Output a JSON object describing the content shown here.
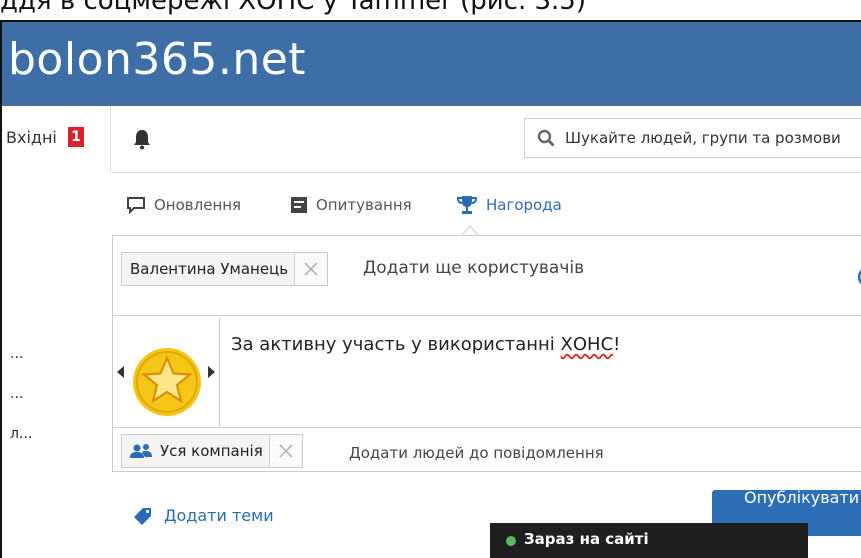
{
  "caption": "ддя в соцмережі ХОНС у Yammer (рис. 3.5)",
  "header": {
    "brand": "bolon365.net"
  },
  "nav": {
    "inbox_label": "Вхідні",
    "inbox_count": "1",
    "search_placeholder": "Шукайте людей, групи та розмови"
  },
  "left_column": {
    "items": [
      "...",
      "...",
      "л..."
    ]
  },
  "composer": {
    "tabs": [
      {
        "label": "Оновлення",
        "icon": "comment-icon"
      },
      {
        "label": "Опитування",
        "icon": "poll-icon"
      },
      {
        "label": "Нагорода",
        "icon": "trophy-icon",
        "active": true
      }
    ],
    "recipient_chip": "Валентина Уманець",
    "add_more_users": "Додати ще користувачів",
    "message_prefix": "За активну участь у використанні ",
    "message_flagged": "ХОНС",
    "message_suffix": "!",
    "audience_chip": "Уся компанія",
    "add_people": "Додати людей до повідомлення",
    "add_topics": "Додати теми",
    "publish_label": "Опублікувати"
  },
  "online": {
    "label": "Зараз на сайті"
  },
  "colors": {
    "brand_bar": "#3d6ea6",
    "accent": "#2a6bb5",
    "badge": "#d9232d",
    "medal": "#f5c518",
    "online_dot": "#5cb85c"
  }
}
